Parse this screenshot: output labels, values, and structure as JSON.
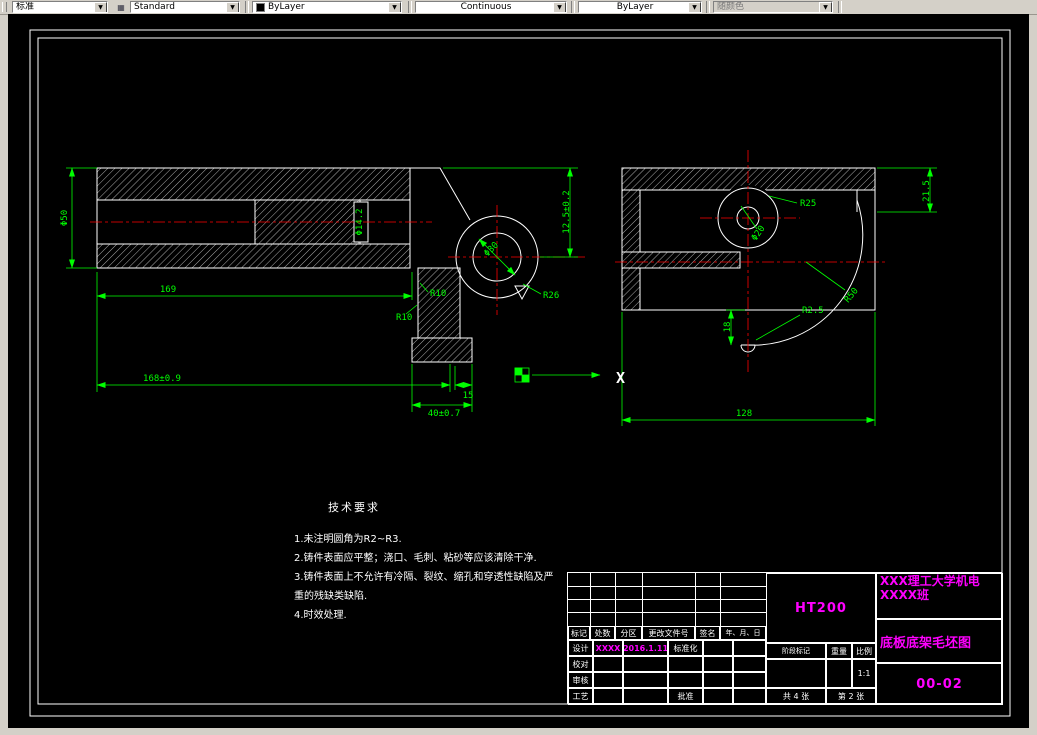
{
  "toolbar": {
    "dim_style": "标准",
    "text_style": "Standard",
    "color": "ByLayer",
    "linetype": "Continuous",
    "lineweight": "ByLayer",
    "plot_style": "随颜色"
  },
  "drawing": {
    "section_label": "X",
    "tech": {
      "title": "技术要求",
      "item1": "1.未注明圆角为R2~R3.",
      "item2": "2.铸件表面应平整；浇口、毛刺、粘砂等应该清除干净.",
      "item3": "3.铸件表面上不允许有冷隔、裂纹、缩孔和穿透性缺陷及严重的残缺类缺陷.",
      "item4": "4.时效处理."
    },
    "dims": {
      "phi50": "Φ50",
      "phi14": "Φ14.2",
      "len169": "169",
      "len168": "168±0.9",
      "len40": "40±0.7",
      "len15": "15",
      "h125": "12.5±0.2",
      "phi30": "Φ30",
      "r26": "R26",
      "r10a": "R10",
      "r10b": "R10",
      "r25": "R25",
      "phi20": "Φ20",
      "h215": "21.5",
      "h18": "18",
      "r25s": "R2.5",
      "r50": "R50",
      "len128": "128"
    }
  },
  "title_block": {
    "material": "HT200",
    "org_line1": "XXX理工大学机电",
    "org_line2": "XXXX班",
    "title": "底板底架毛坯图",
    "number": "00-02",
    "h_mark": "标记",
    "h_count": "处数",
    "h_zone": "分区",
    "h_doc": "更改文件号",
    "h_sign": "签名",
    "h_date": "年、月、日",
    "design": "设计",
    "design_name": "XXXX",
    "design_date": "2016.1.11",
    "standardize": "标准化",
    "check": "校对",
    "audit": "审核",
    "craft": "工艺",
    "approve": "批准",
    "stage": "阶段标记",
    "weight": "重量",
    "scale": "比例",
    "scale_val": "1:1",
    "sheets": "共 4 张",
    "sheet": "第 2 张"
  }
}
